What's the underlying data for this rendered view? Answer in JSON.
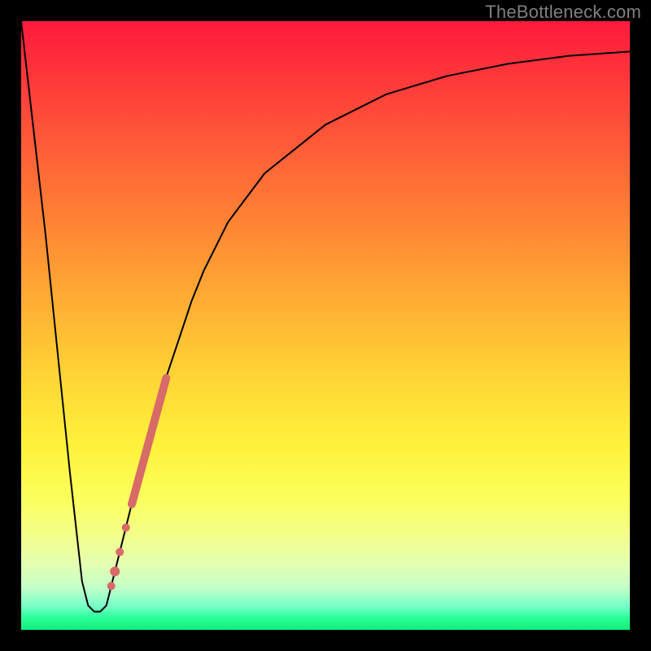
{
  "watermark": "TheBottleneck.com",
  "chart_data": {
    "type": "line",
    "title": "",
    "xlabel": "",
    "ylabel": "",
    "xlim": [
      0,
      100
    ],
    "ylim": [
      0,
      100
    ],
    "x": [
      0,
      4,
      8,
      10,
      11,
      12,
      13,
      14,
      16,
      18,
      20,
      22,
      24,
      26,
      28,
      30,
      34,
      40,
      50,
      60,
      70,
      80,
      90,
      100
    ],
    "values": [
      100,
      65,
      26,
      8,
      4,
      3,
      3,
      4,
      12,
      20,
      28,
      35,
      42,
      48,
      54,
      59,
      67,
      75,
      83,
      88,
      91,
      93,
      94.3,
      95
    ],
    "highlight_segment": {
      "x_start": 18,
      "x_end": 24,
      "thickness": 10
    },
    "highlight_dots": [
      {
        "x": 17.2,
        "r": 5
      },
      {
        "x": 16.2,
        "r": 5
      },
      {
        "x": 15.4,
        "r": 6
      },
      {
        "x": 14.8,
        "r": 5
      }
    ],
    "colors": {
      "curve": "#000000",
      "highlight": "#d86a68",
      "background_top": "#ff1a3c",
      "background_bottom": "#10f07a"
    }
  }
}
